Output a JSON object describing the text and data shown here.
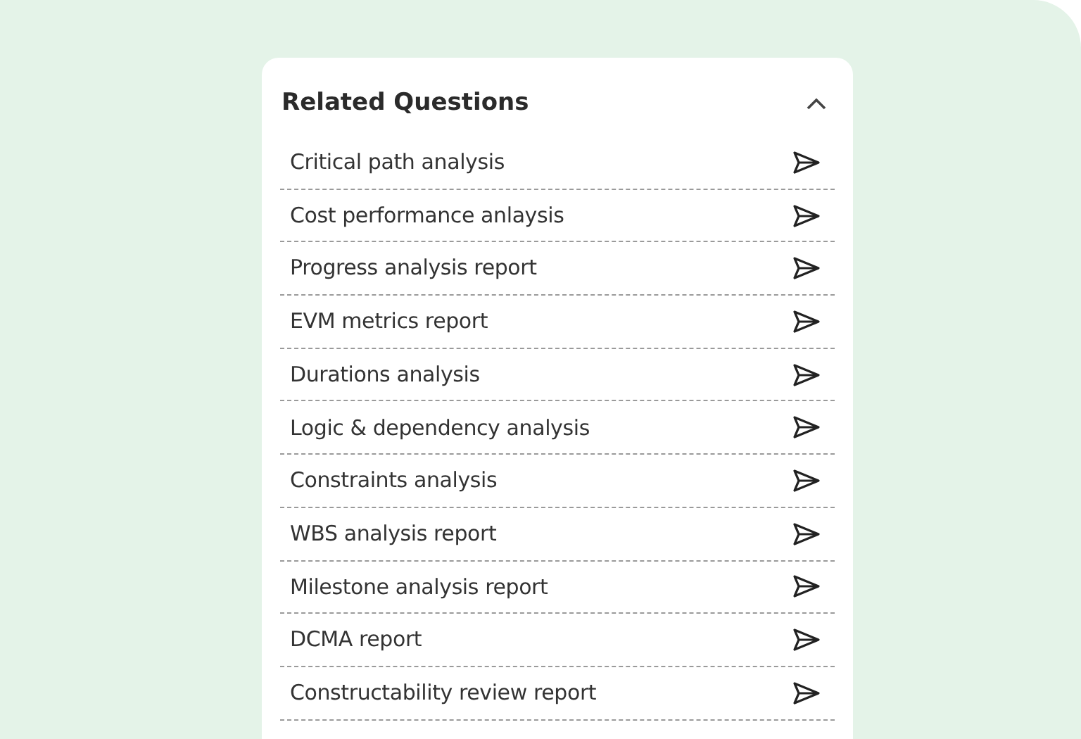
{
  "panel": {
    "title": "Related Questions",
    "expanded": true,
    "questions": [
      {
        "text": "Critical path analysis"
      },
      {
        "text": "Cost performance anlaysis"
      },
      {
        "text": "Progress analysis report"
      },
      {
        "text": "EVM metrics report"
      },
      {
        "text": "Durations analysis"
      },
      {
        "text": "Logic & dependency analysis"
      },
      {
        "text": "Constraints analysis"
      },
      {
        "text": "WBS analysis report"
      },
      {
        "text": "Milestone analysis report"
      },
      {
        "text": "DCMA report"
      },
      {
        "text": "Constructability review report"
      }
    ]
  }
}
